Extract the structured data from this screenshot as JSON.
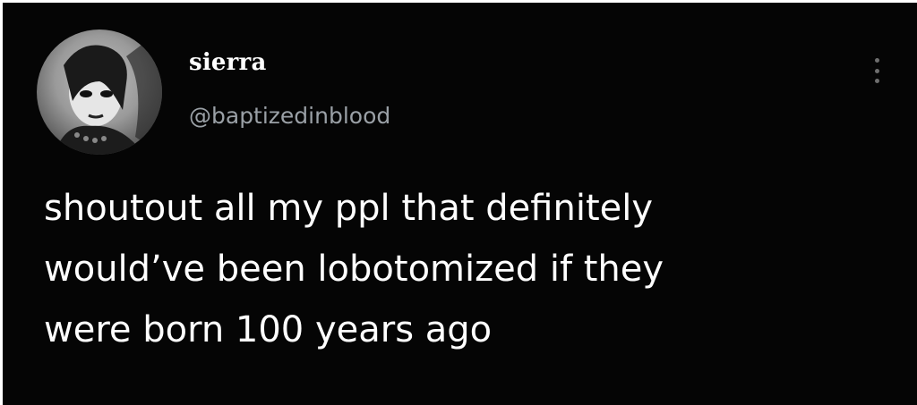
{
  "tweet": {
    "author": {
      "display_name": "sierra",
      "handle": "@baptizedinblood",
      "avatar_icon": "avatar-photo"
    },
    "text_lines": [
      "shoutout all my ppl that definitely",
      "would’ve been lobotomized if they",
      "were born 100 years ago"
    ],
    "more_icon": "more-vertical-icon"
  },
  "colors": {
    "background": "#050505",
    "text": "#ffffff",
    "handle": "#9aa0a6",
    "link": "#2f62c4"
  }
}
